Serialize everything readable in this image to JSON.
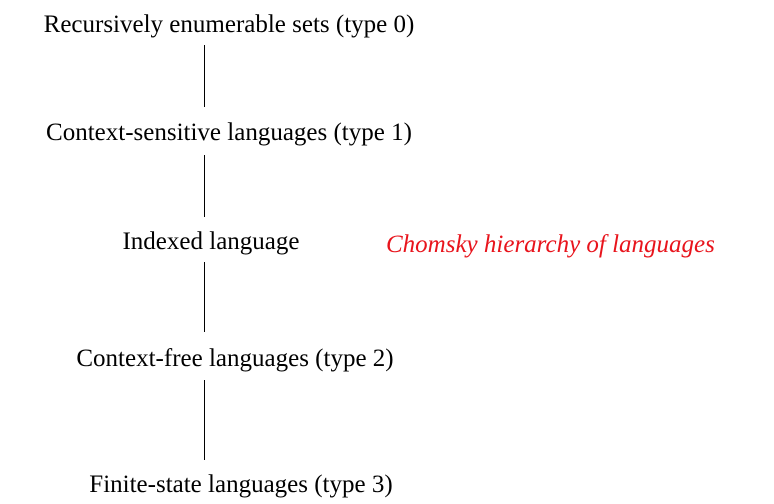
{
  "diagram": {
    "nodes": [
      {
        "id": "type0",
        "label": "Recursively enumerable sets (type 0)"
      },
      {
        "id": "type1",
        "label": "Context-sensitive languages (type 1)"
      },
      {
        "id": "indexed",
        "label": "Indexed language"
      },
      {
        "id": "type2",
        "label": "Context-free languages (type 2)"
      },
      {
        "id": "type3",
        "label": "Finite-state languages (type 3)"
      }
    ],
    "edges": [
      {
        "from": "type0",
        "to": "type1"
      },
      {
        "from": "type1",
        "to": "indexed"
      },
      {
        "from": "indexed",
        "to": "type2"
      },
      {
        "from": "type2",
        "to": "type3"
      }
    ],
    "caption": "Chomsky hierarchy of languages",
    "caption_color": "#e8141c",
    "line_color": "#000000",
    "text_color": "#000000"
  }
}
